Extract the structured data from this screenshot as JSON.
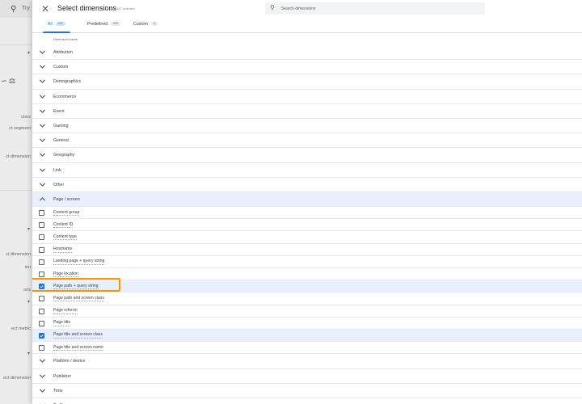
{
  "background_app": {
    "search_icon": "search-icon",
    "try_text": "Try",
    "texts": [
      {
        "label": "ctors"
      },
      {
        "label": "ct segment"
      },
      {
        "label": "ct dimension"
      },
      {
        "label": "ct dimension"
      },
      {
        "label": "ion"
      },
      {
        "label": "ons"
      },
      {
        "label": "ect metric"
      },
      {
        "label": "ect dimension"
      }
    ]
  },
  "panel": {
    "close_icon": "close-icon",
    "title": "Select dimensions",
    "selected_count": "2 of 247 selected",
    "search": {
      "placeholder": "Search dimensions",
      "value": ""
    }
  },
  "tabs": [
    {
      "label": "All",
      "count": "247",
      "active": true
    },
    {
      "label": "Predefined",
      "count": "247",
      "active": false
    },
    {
      "label": "Custom",
      "count": "0",
      "active": false
    }
  ],
  "column_header": "Dimension name",
  "categories": [
    {
      "label": "Attribution",
      "expanded": false,
      "items": []
    },
    {
      "label": "Custom",
      "expanded": false,
      "items": []
    },
    {
      "label": "Demographics",
      "expanded": false,
      "items": []
    },
    {
      "label": "Ecommerce",
      "expanded": false,
      "items": []
    },
    {
      "label": "Event",
      "expanded": false,
      "items": []
    },
    {
      "label": "Gaming",
      "expanded": false,
      "items": []
    },
    {
      "label": "General",
      "expanded": false,
      "items": []
    },
    {
      "label": "Geography",
      "expanded": false,
      "items": []
    },
    {
      "label": "Link",
      "expanded": false,
      "items": []
    },
    {
      "label": "Other",
      "expanded": false,
      "items": []
    },
    {
      "label": "Page / screen",
      "expanded": true,
      "items": [
        {
          "label": "Content group",
          "checked": false
        },
        {
          "label": "Content ID",
          "checked": false
        },
        {
          "label": "Content type",
          "checked": false
        },
        {
          "label": "Hostname",
          "checked": false
        },
        {
          "label": "Landing page + query string",
          "checked": false
        },
        {
          "label": "Page location",
          "checked": false
        },
        {
          "label": "Page path + query string",
          "checked": true,
          "highlighted": true
        },
        {
          "label": "Page path and screen class",
          "checked": false
        },
        {
          "label": "Page referrer",
          "checked": false
        },
        {
          "label": "Page title",
          "checked": false
        },
        {
          "label": "Page title and screen class",
          "checked": true
        },
        {
          "label": "Page title and screen name",
          "checked": false
        }
      ]
    },
    {
      "label": "Platform / device",
      "expanded": false,
      "items": []
    },
    {
      "label": "Publisher",
      "expanded": false,
      "items": []
    },
    {
      "label": "Time",
      "expanded": false,
      "items": []
    },
    {
      "label": "Traffic source",
      "expanded": false,
      "items": []
    }
  ],
  "colors": {
    "accent": "#1a73e8",
    "selected_row": "#e8f0fe",
    "highlight": "#f29900"
  }
}
